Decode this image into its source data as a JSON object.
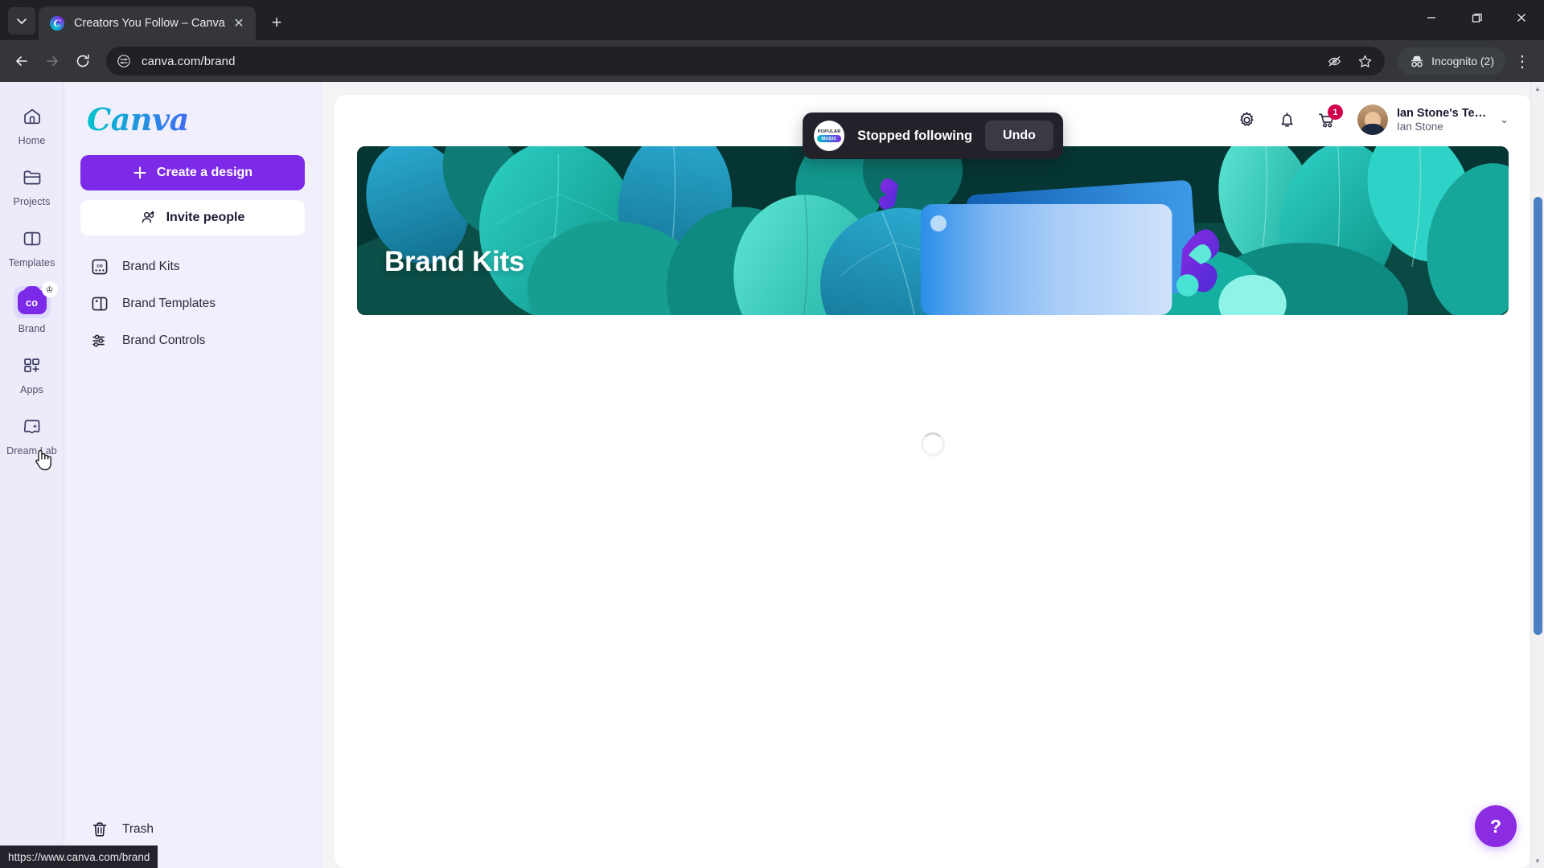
{
  "browser": {
    "tab": {
      "title": "Creators You Follow – Canva",
      "favicon_letter": "C",
      "close_glyph": "✕"
    },
    "newtab_glyph": "+",
    "tab_list_glyph": "⌄",
    "window_controls": {
      "minimize": "—",
      "maximize": "❐",
      "close": "✕"
    },
    "nav": {
      "back_glyph": "←",
      "forward_glyph": "→",
      "reload_glyph": "⟳"
    },
    "omnibox": {
      "url": "canva.com/brand",
      "site_settings_icon": "tune-icon",
      "hide_icon_glyph": "👁",
      "bookmark_glyph": "☆"
    },
    "incognito": {
      "label": "Incognito (2)",
      "icon": "incognito-icon"
    },
    "menu_glyph": "⋮",
    "status_link": "https://www.canva.com/brand"
  },
  "rail": {
    "items": [
      {
        "label": "Home",
        "icon": "home-icon",
        "active": false
      },
      {
        "label": "Projects",
        "icon": "folder-icon",
        "active": false
      },
      {
        "label": "Templates",
        "icon": "templates-icon",
        "active": false
      },
      {
        "label": "Brand",
        "icon": "brand-icon",
        "active": true,
        "badge": "crown-icon",
        "badge_glyph": "♔"
      },
      {
        "label": "Apps",
        "icon": "apps-icon",
        "active": false
      },
      {
        "label": "Dream Lab",
        "icon": "dream-lab-icon",
        "active": false
      }
    ]
  },
  "sidebar": {
    "logo": "Canva",
    "create_button": {
      "label": "Create a design",
      "icon_glyph": "+"
    },
    "invite_button": {
      "label": "Invite people",
      "icon": "add-people-icon"
    },
    "nav_items": [
      {
        "label": "Brand Kits",
        "icon": "brand-kit-icon"
      },
      {
        "label": "Brand Templates",
        "icon": "brand-template-icon"
      },
      {
        "label": "Brand Controls",
        "icon": "sliders-icon"
      }
    ],
    "trash": {
      "label": "Trash",
      "icon": "trash-icon"
    }
  },
  "header": {
    "settings_icon": "gear-icon",
    "notifications_icon": "bell-icon",
    "cart_icon": "cart-icon",
    "cart_badge": "1",
    "user": {
      "team": "Ian Stone's Te…",
      "name": "Ian Stone",
      "chevron_glyph": "⌄"
    }
  },
  "banner": {
    "title": "Brand Kits"
  },
  "toast": {
    "message": "Stopped following",
    "undo_label": "Undo",
    "avatar_top": "POPULAR",
    "avatar_bottom": "MUSIC"
  },
  "help": {
    "glyph": "?"
  },
  "colors": {
    "canva_purple": "#7d2ae8",
    "rail_bg": "#ecebfa",
    "sidebar_bg": "#f1effc",
    "toast_bg": "#23222b",
    "cart_badge": "#d1004b",
    "banner_teal": "#063a3a",
    "scrollbar_thumb": "#4a7fc1"
  }
}
